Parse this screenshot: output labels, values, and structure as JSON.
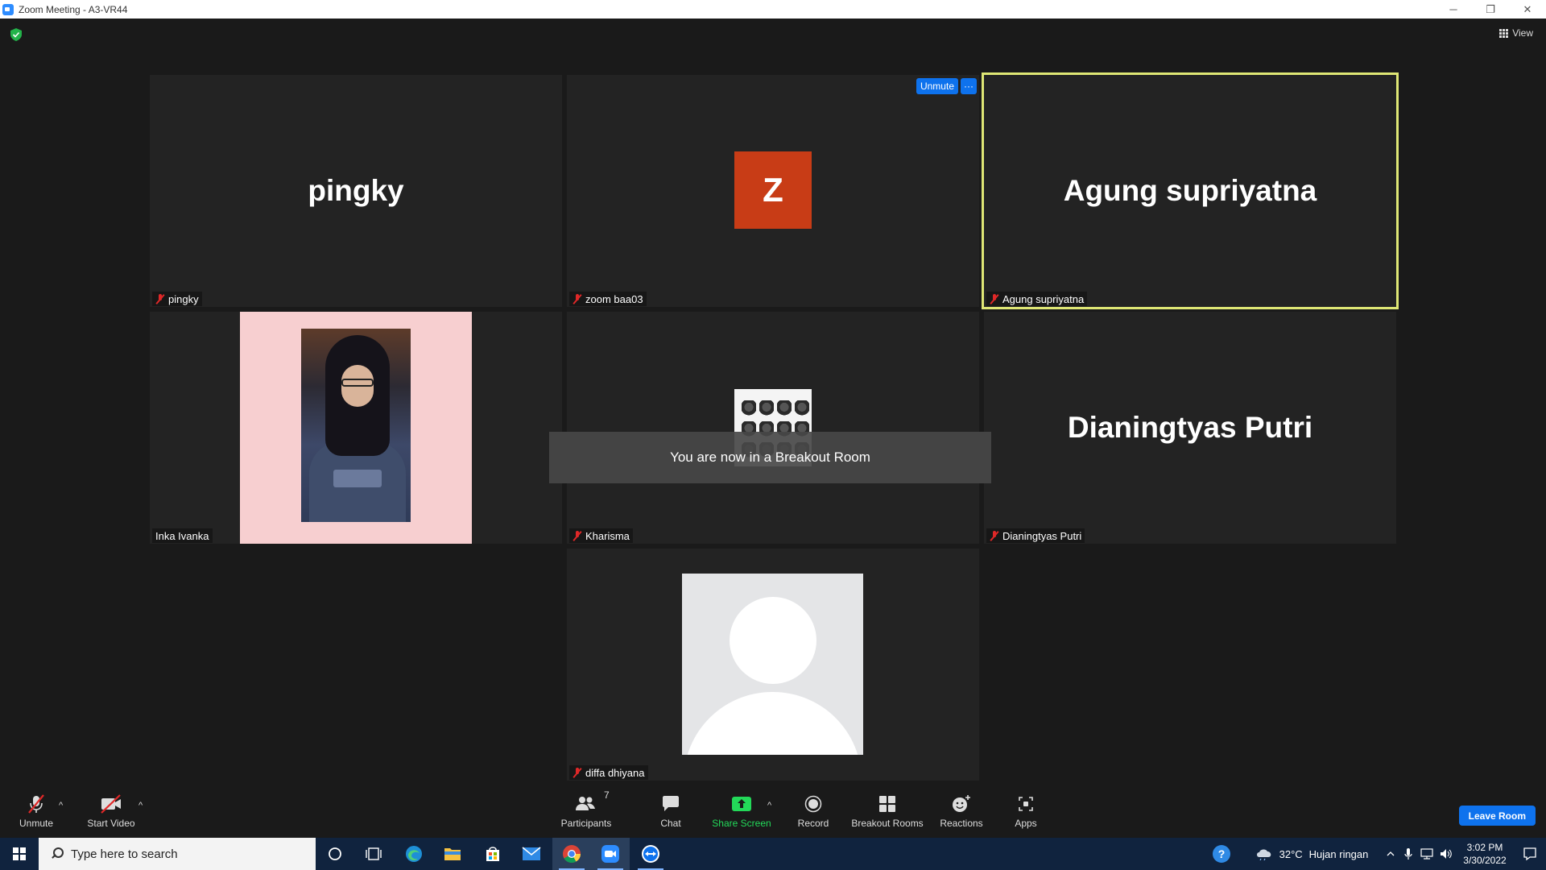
{
  "window": {
    "title": "Zoom Meeting - A3-VR44",
    "minimize_glyph": "─",
    "restore_glyph": "❐",
    "close_glyph": "✕"
  },
  "header": {
    "view_label": "View",
    "security_icon": "shield-check-icon"
  },
  "tiles": [
    {
      "id": "pingky",
      "big_name": "pingky",
      "label": "pingky",
      "muted": true
    },
    {
      "id": "zoom",
      "avatar_letter": "Z",
      "label": "zoom baa03",
      "muted": true,
      "unmute_label": "Unmute",
      "more_label": "···"
    },
    {
      "id": "agung",
      "big_name": "Agung supriyatna",
      "label": "Agung supriyatna",
      "muted": true,
      "active_speaker": true,
      "highlight_color": "#dfe775"
    },
    {
      "id": "inka",
      "label": "Inka Ivanka",
      "muted": false,
      "video": true
    },
    {
      "id": "kharisma",
      "label": "Kharisma",
      "muted": true
    },
    {
      "id": "dianing",
      "big_name": "Dianingtyas Putri",
      "label": "Dianingtyas Putri",
      "muted": true
    },
    {
      "id": "diffa",
      "label": "diffa dhiyana",
      "muted": true
    }
  ],
  "toast": {
    "message": "You are now in a Breakout Room"
  },
  "toolbar": {
    "unmute_label": "Unmute",
    "video_label": "Start Video",
    "participants_label": "Participants",
    "participants_count": "7",
    "chat_label": "Chat",
    "share_label": "Share Screen",
    "record_label": "Record",
    "breakout_label": "Breakout Rooms",
    "reactions_label": "Reactions",
    "apps_label": "Apps",
    "leave_label": "Leave Room",
    "caret": "^"
  },
  "taskbar": {
    "search_placeholder": "Type here to search",
    "apps": [
      "cortana-icon",
      "task-view-icon",
      "edge-icon",
      "file-explorer-icon",
      "microsoft-store-icon",
      "mail-icon",
      "chrome-icon",
      "zoom-icon",
      "teamviewer-icon"
    ],
    "weather_temp": "32°C",
    "weather_desc": "Hujan ringan",
    "time": "3:02 PM",
    "date": "3/30/2022",
    "help_glyph": "?"
  },
  "colors": {
    "accent_blue": "#0e72ed",
    "share_green": "#23d959",
    "muted_red": "#e02828",
    "taskbar_bg": "#10233e"
  }
}
